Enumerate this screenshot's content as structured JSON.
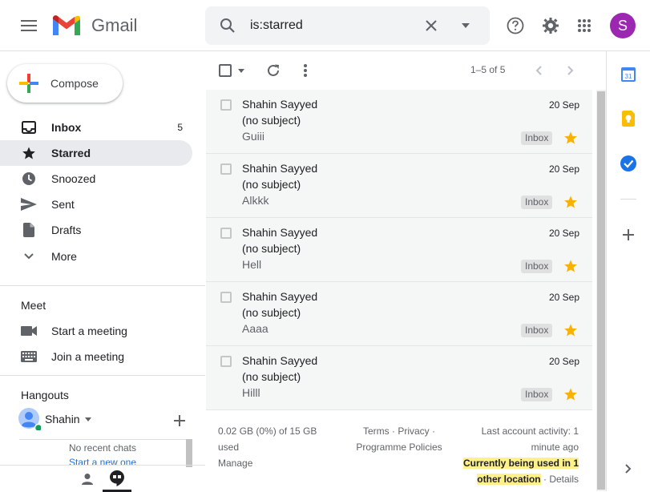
{
  "header": {
    "logo_text": "Gmail",
    "search_value": "is:starred",
    "avatar_letter": "S",
    "brand_colors": {
      "red": "#ea4335",
      "blue": "#4285f4",
      "yellow": "#fbbc04",
      "green": "#34a853"
    }
  },
  "sidebar": {
    "compose_label": "Compose",
    "nav": [
      {
        "label": "Inbox",
        "count": "5",
        "icon": "inbox-icon"
      },
      {
        "label": "Starred",
        "count": "",
        "icon": "star-icon"
      },
      {
        "label": "Snoozed",
        "count": "",
        "icon": "clock-icon"
      },
      {
        "label": "Sent",
        "count": "",
        "icon": "send-icon"
      },
      {
        "label": "Drafts",
        "count": "",
        "icon": "draft-icon"
      },
      {
        "label": "More",
        "count": "",
        "icon": "chevron-down-icon"
      }
    ],
    "meet": {
      "title": "Meet",
      "start": "Start a meeting",
      "join": "Join a meeting"
    },
    "hangouts": {
      "title": "Hangouts",
      "user": "Shahin",
      "no_recent": "No recent chats",
      "start_new": "Start a new one"
    }
  },
  "toolbar": {
    "pagination": "1–5 of 5"
  },
  "emails": [
    {
      "sender": "Shahin Sayyed",
      "subject": "(no subject)",
      "snippet": "Guiii",
      "date": "20 Sep",
      "label": "Inbox"
    },
    {
      "sender": "Shahin Sayyed",
      "subject": "(no subject)",
      "snippet": "Alkkk",
      "date": "20 Sep",
      "label": "Inbox"
    },
    {
      "sender": "Shahin Sayyed",
      "subject": "(no subject)",
      "snippet": "Hell",
      "date": "20 Sep",
      "label": "Inbox"
    },
    {
      "sender": "Shahin Sayyed",
      "subject": "(no subject)",
      "snippet": "Aaaa",
      "date": "20 Sep",
      "label": "Inbox"
    },
    {
      "sender": "Shahin Sayyed",
      "subject": "(no subject)",
      "snippet": "Hilll",
      "date": "20 Sep",
      "label": "Inbox"
    }
  ],
  "footer": {
    "storage_line1": "0.02 GB (0%) of 15 GB",
    "storage_line2": "used",
    "manage": "Manage",
    "terms": "Terms",
    "privacy": "Privacy",
    "policies": "Programme Policies",
    "activity_line1": "Last account activity: 1",
    "activity_line2": "minute ago",
    "current_line1": "Currently being used in 1",
    "current_line2": "other location",
    "details": "Details"
  },
  "right_panel": {
    "calendar_day": "31"
  }
}
